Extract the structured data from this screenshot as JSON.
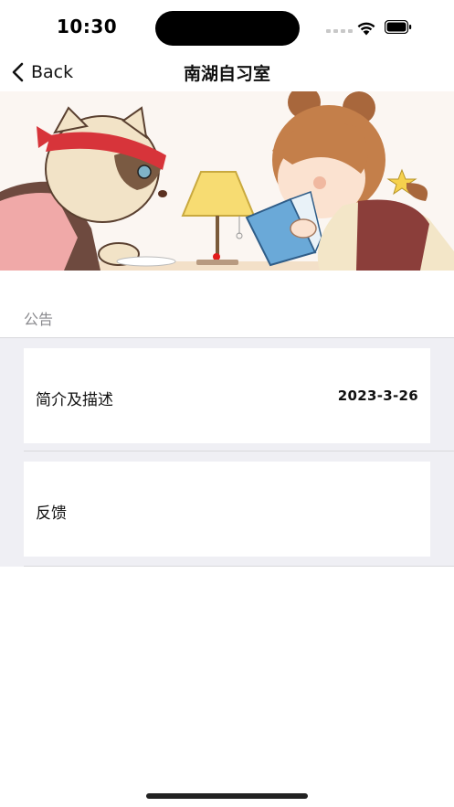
{
  "status_bar": {
    "time": "10:30",
    "icons": [
      "cellular-signal-icon",
      "wifi-icon",
      "battery-icon"
    ]
  },
  "nav": {
    "back_label": "Back",
    "title": "南湖自习室",
    "back_icon": "chevron-left-icon"
  },
  "banner": {
    "image": "anime-style illustration: cat with red headband and girl reading book under desk lamp"
  },
  "section": {
    "title": "公告"
  },
  "list": {
    "items": [
      {
        "label": "简介及描述",
        "value": "2023-3-26"
      },
      {
        "label": "反馈",
        "value": ""
      }
    ]
  },
  "colors": {
    "background": "#ffffff",
    "grouped_background": "#efeff4",
    "secondary_text": "#8a8a8e",
    "separator": "#d9d9dc"
  }
}
